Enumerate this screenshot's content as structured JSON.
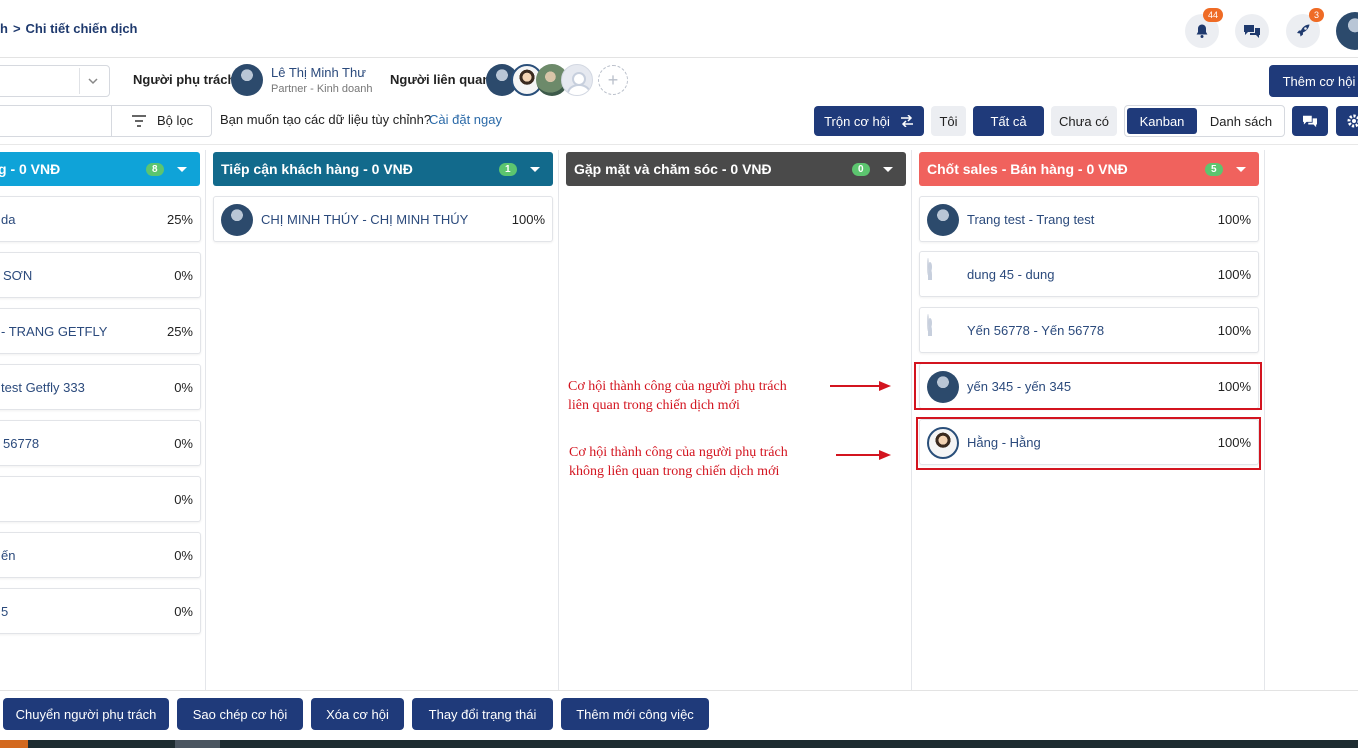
{
  "breadcrumb": {
    "prev": "h",
    "current": "Chi tiết chiến dịch"
  },
  "header": {
    "notifications_count": "44",
    "rocket_count": "3"
  },
  "filters": {
    "owner_label": "Người phụ trách",
    "owner_name": "Lê Thị Minh Thư",
    "owner_role": "Partner - Kinh doanh",
    "related_label": "Người liên quan",
    "add_opportunity": "Thêm cơ hội",
    "filter_label": "Bộ lọc",
    "custom_prompt": "Bạn muốn tạo các dữ liệu tùy chỉnh?",
    "custom_link": "Cài đặt ngay",
    "merge_label": "Trộn cơ hội",
    "me_label": "Tôi",
    "all_label": "Tất cả",
    "none_label": "Chưa có",
    "kanban_label": "Kanban",
    "list_label": "Danh sách"
  },
  "columns": [
    {
      "title": "g - 0 VNĐ",
      "count": "8",
      "color": "#0fa3d8",
      "cards": [
        {
          "name": "da",
          "pct": "25%"
        },
        {
          "name": "SƠN",
          "pct": "0%"
        },
        {
          "name": "- TRANG GETFLY",
          "pct": "25%"
        },
        {
          "name": "test Getfly 333",
          "pct": "0%"
        },
        {
          "name": "56778",
          "pct": "0%"
        },
        {
          "name": "",
          "pct": "0%"
        },
        {
          "name": "ến",
          "pct": "0%"
        },
        {
          "name": "5",
          "pct": "0%"
        }
      ]
    },
    {
      "title": "Tiếp cận khách hàng - 0 VNĐ",
      "count": "1",
      "color": "#126a8c",
      "cards": [
        {
          "name": "CHỊ MINH THÚY - CHỊ MINH THÚY",
          "pct": "100%"
        }
      ]
    },
    {
      "title": "Gặp mặt và chăm sóc - 0 VNĐ",
      "count": "0",
      "color": "#4a4a4a",
      "cards": []
    },
    {
      "title": "Chốt sales - Bán hàng - 0 VNĐ",
      "count": "5",
      "color": "#f0625d",
      "cards": [
        {
          "name": "Trang test - Trang test",
          "pct": "100%"
        },
        {
          "name": "dung 45 - dung",
          "pct": "100%"
        },
        {
          "name": "Yến 56778 - Yến 56778",
          "pct": "100%"
        },
        {
          "name": "yến 345 - yến 345",
          "pct": "100%"
        },
        {
          "name": "Hằng - Hằng",
          "pct": "100%"
        }
      ]
    }
  ],
  "annotations": {
    "note1_line1": "Cơ hội thành công của người phụ trách",
    "note1_line2": "liên quan trong chiến dịch mới",
    "note2_line1": "Cơ hội thành công của người phụ trách",
    "note2_line2": "không liên quan trong chiến dịch mới"
  },
  "actions": {
    "transfer": "Chuyển người phụ trách",
    "copy": "Sao chép cơ hội",
    "delete": "Xóa cơ hội",
    "change_status": "Thay đổi trạng thái",
    "add_task": "Thêm mới công việc"
  }
}
